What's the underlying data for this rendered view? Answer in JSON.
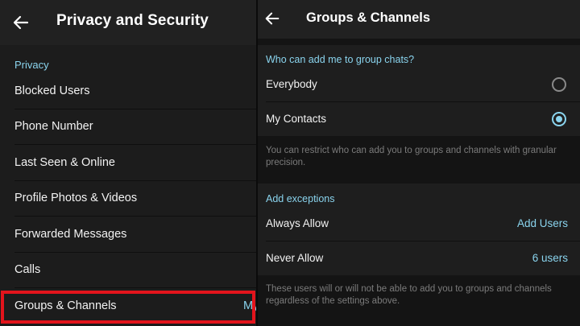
{
  "left": {
    "title": "Privacy and Security",
    "back_icon": "back-arrow-icon",
    "section_title": "Privacy",
    "items": [
      {
        "label": "Blocked Users"
      },
      {
        "label": "Phone Number"
      },
      {
        "label": "Last Seen & Online"
      },
      {
        "label": "Profile Photos & Videos"
      },
      {
        "label": "Forwarded Messages"
      },
      {
        "label": "Calls"
      },
      {
        "label": "Groups & Channels",
        "value": "My"
      }
    ]
  },
  "right": {
    "title": "Groups & Channels",
    "back_icon": "back-arrow-icon",
    "who_title": "Who can add me to group chats?",
    "options": [
      {
        "label": "Everybody",
        "selected": false
      },
      {
        "label": "My Contacts",
        "selected": true
      }
    ],
    "restrict_note": "You can restrict who can add you to groups and channels with granular precision.",
    "exceptions_title": "Add exceptions",
    "exceptions": [
      {
        "label": "Always Allow",
        "value": "Add Users"
      },
      {
        "label": "Never Allow",
        "value": "6 users"
      }
    ],
    "exceptions_note": "These users will or will not be able to add you to groups and channels regardless of the settings above."
  },
  "colors": {
    "accent": "#8ad4ee",
    "highlight_border": "#e3141c",
    "background": "#1c1c1c",
    "header": "#212121"
  }
}
